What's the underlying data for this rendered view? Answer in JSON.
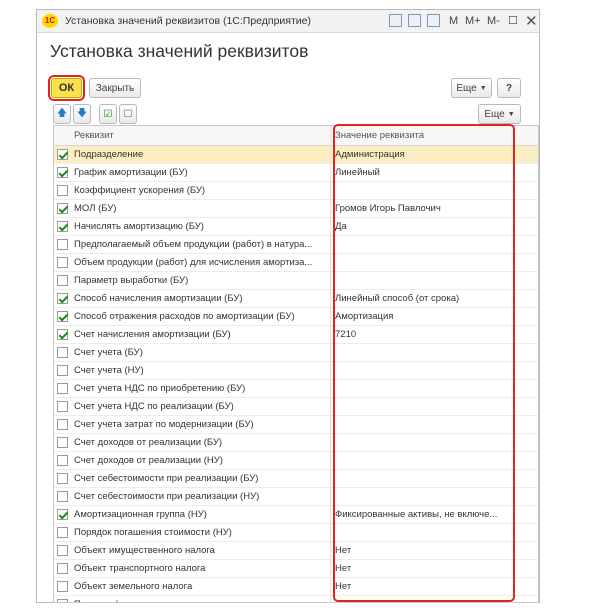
{
  "window": {
    "app_logo": "1С",
    "title": "Установка значений реквизитов  (1С:Предприятие)",
    "titlebar_buttons": [
      "М",
      "М+",
      "М-"
    ],
    "close_glyph": "✕",
    "restore_glyph": "☐"
  },
  "heading": "Установка значений реквизитов",
  "toolbar": {
    "ok_label": "ОК",
    "close_label": "Закрыть",
    "more_label": "Еще",
    "help_label": "?"
  },
  "grid_toolbar": {
    "more_label": "Еще"
  },
  "table": {
    "columns": [
      "Реквизит",
      "Значение реквизита"
    ],
    "rows": [
      {
        "checked": true,
        "name": "Подразделение",
        "value": "Администрация",
        "selected": true
      },
      {
        "checked": true,
        "name": "График амортизации (БУ)",
        "value": "Линейный"
      },
      {
        "checked": false,
        "name": "Коэффициент ускорения (БУ)",
        "value": ""
      },
      {
        "checked": true,
        "name": "МОЛ (БУ)",
        "value": "Громов Игорь Павлочич"
      },
      {
        "checked": true,
        "name": "Начислять амортизацию (БУ)",
        "value": "Да"
      },
      {
        "checked": false,
        "name": "Предполагаемый объем продукции (работ) в натура...",
        "value": ""
      },
      {
        "checked": false,
        "name": "Объем продукции (работ) для исчисления амортиза...",
        "value": ""
      },
      {
        "checked": false,
        "name": "Параметр выработки (БУ)",
        "value": ""
      },
      {
        "checked": true,
        "name": "Способ начисления амортизации (БУ)",
        "value": "Линейный способ (от срока)"
      },
      {
        "checked": true,
        "name": "Способ отражения расходов по амортизации (БУ)",
        "value": "Амортизация"
      },
      {
        "checked": true,
        "name": "Счет начисления амортизации (БУ)",
        "value": "7210"
      },
      {
        "checked": false,
        "name": "Счет учета (БУ)",
        "value": ""
      },
      {
        "checked": false,
        "name": "Счет учета (НУ)",
        "value": ""
      },
      {
        "checked": false,
        "name": "Счет учета НДС по приобретению (БУ)",
        "value": ""
      },
      {
        "checked": false,
        "name": "Счет учета НДС по реализации (БУ)",
        "value": ""
      },
      {
        "checked": false,
        "name": "Счет учета затрат по модернизации (БУ)",
        "value": ""
      },
      {
        "checked": false,
        "name": "Счет доходов от реализации (БУ)",
        "value": ""
      },
      {
        "checked": false,
        "name": "Счет доходов от реализации (НУ)",
        "value": ""
      },
      {
        "checked": false,
        "name": "Счет себестоимости при реализации (БУ)",
        "value": ""
      },
      {
        "checked": false,
        "name": "Счет себестоимости при реализации (НУ)",
        "value": ""
      },
      {
        "checked": true,
        "name": "Амортизационная группа (НУ)",
        "value": "Фиксированные активы, не включе..."
      },
      {
        "checked": false,
        "name": "Порядок погашения стоимости (НУ)",
        "value": ""
      },
      {
        "checked": false,
        "name": "Объект имущественного налога",
        "value": "Нет"
      },
      {
        "checked": false,
        "name": "Объект транспортного налога",
        "value": "Нет"
      },
      {
        "checked": false,
        "name": "Объект земельного налога",
        "value": "Нет"
      },
      {
        "checked": true,
        "name": "Признак фиксированного актива",
        "value": "Да"
      }
    ]
  },
  "colors": {
    "ok_button": "#fbe14a",
    "highlight_border": "#e0251f",
    "selected_row": "#fbeec0",
    "checkmark": "#1e8a1e"
  }
}
